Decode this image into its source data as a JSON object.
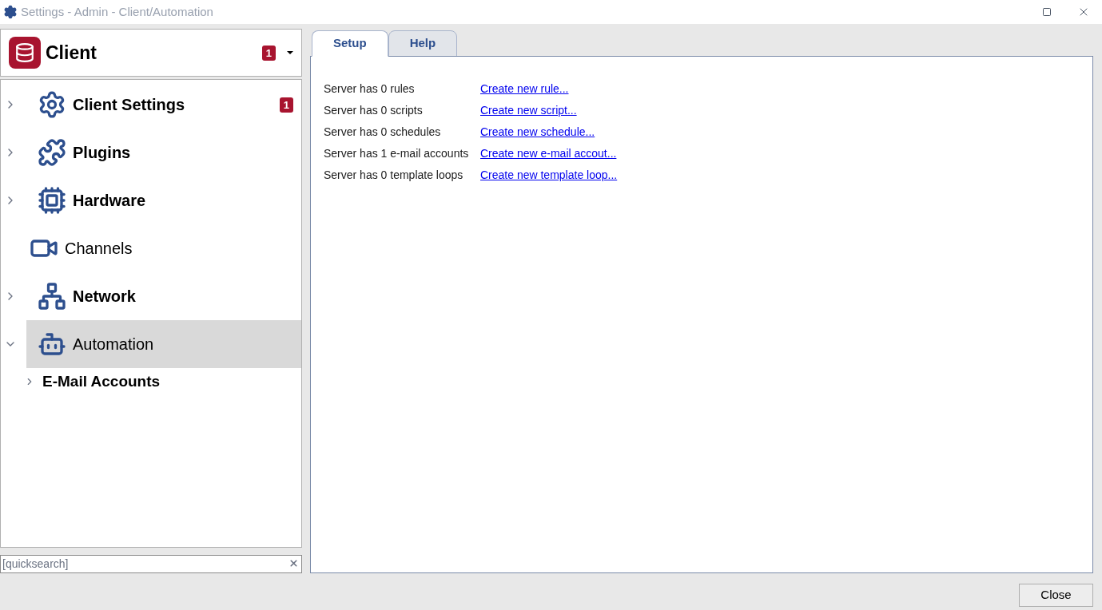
{
  "window": {
    "title": "Settings - Admin - Client/Automation"
  },
  "client": {
    "label": "Client",
    "badge": "1"
  },
  "tree": [
    {
      "label": "Client Settings",
      "bold": true,
      "expanded": false,
      "selected": false,
      "badge": "1"
    },
    {
      "label": "Plugins",
      "bold": true,
      "expanded": false,
      "selected": false
    },
    {
      "label": "Hardware",
      "bold": true,
      "expanded": false,
      "selected": false
    },
    {
      "label": "Channels",
      "bold": false,
      "selected": false
    },
    {
      "label": "Network",
      "bold": true,
      "expanded": false,
      "selected": false
    },
    {
      "label": "Automation",
      "bold": false,
      "expanded": true,
      "selected": true,
      "children": [
        {
          "label": "E-Mail Accounts",
          "bold": true,
          "expanded": false,
          "selected": false
        }
      ]
    }
  ],
  "search": {
    "placeholder": "[quicksearch]"
  },
  "tabs": [
    {
      "label": "Setup",
      "selected": true
    },
    {
      "label": "Help",
      "selected": false
    }
  ],
  "rows": [
    {
      "text": "Server has 0 rules",
      "link": "Create new rule..."
    },
    {
      "text": "Server has 0 scripts",
      "link": "Create new script..."
    },
    {
      "text": "Server has 0 schedules",
      "link": "Create new schedule..."
    },
    {
      "text": "Server has 1 e-mail accounts",
      "link": "Create new e-mail accout..."
    },
    {
      "text": "Server has 0 template loops",
      "link": "Create new template loop..."
    }
  ],
  "buttons": [
    {
      "label": "Close"
    }
  ]
}
